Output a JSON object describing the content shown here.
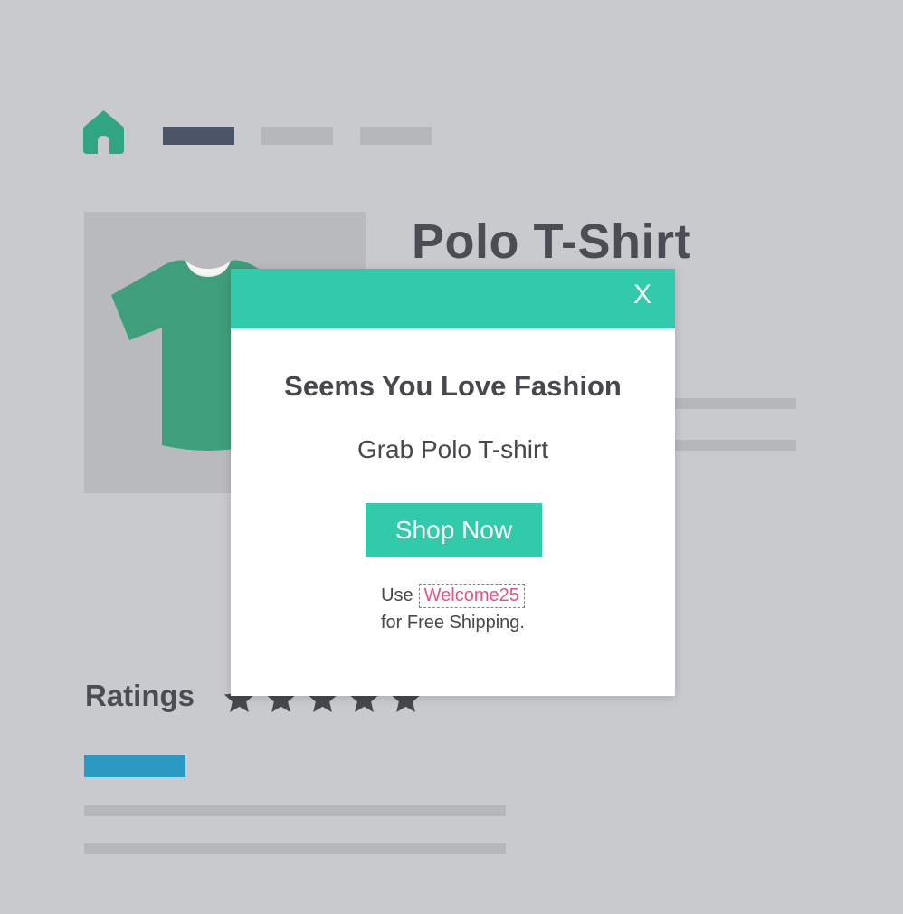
{
  "colors": {
    "background": "#c9cace",
    "accent": "#31cbab",
    "nav_active": "#4b5565",
    "placeholder": "#b6b7bb",
    "text_dark": "#4a4d53",
    "coupon": "#e9547f",
    "link_bar": "#2a9ac5",
    "shirt": "#3f9e7b"
  },
  "nav": {
    "home_icon": "home-icon",
    "items": [
      {
        "state": "active"
      },
      {
        "state": "inactive"
      },
      {
        "state": "inactive"
      }
    ]
  },
  "product": {
    "title": "Polo T-Shirt",
    "image_icon": "tshirt-icon"
  },
  "ratings": {
    "label": "Ratings",
    "stars": 5,
    "star_icon": "star-icon"
  },
  "popup": {
    "close_label": "X",
    "heading": "Seems You Love Fashion",
    "subheading": "Grab Polo T-shirt",
    "cta_label": "Shop Now",
    "coupon_prefix": "Use",
    "coupon_code": "Welcome25",
    "shipping_text": "for Free Shipping."
  }
}
